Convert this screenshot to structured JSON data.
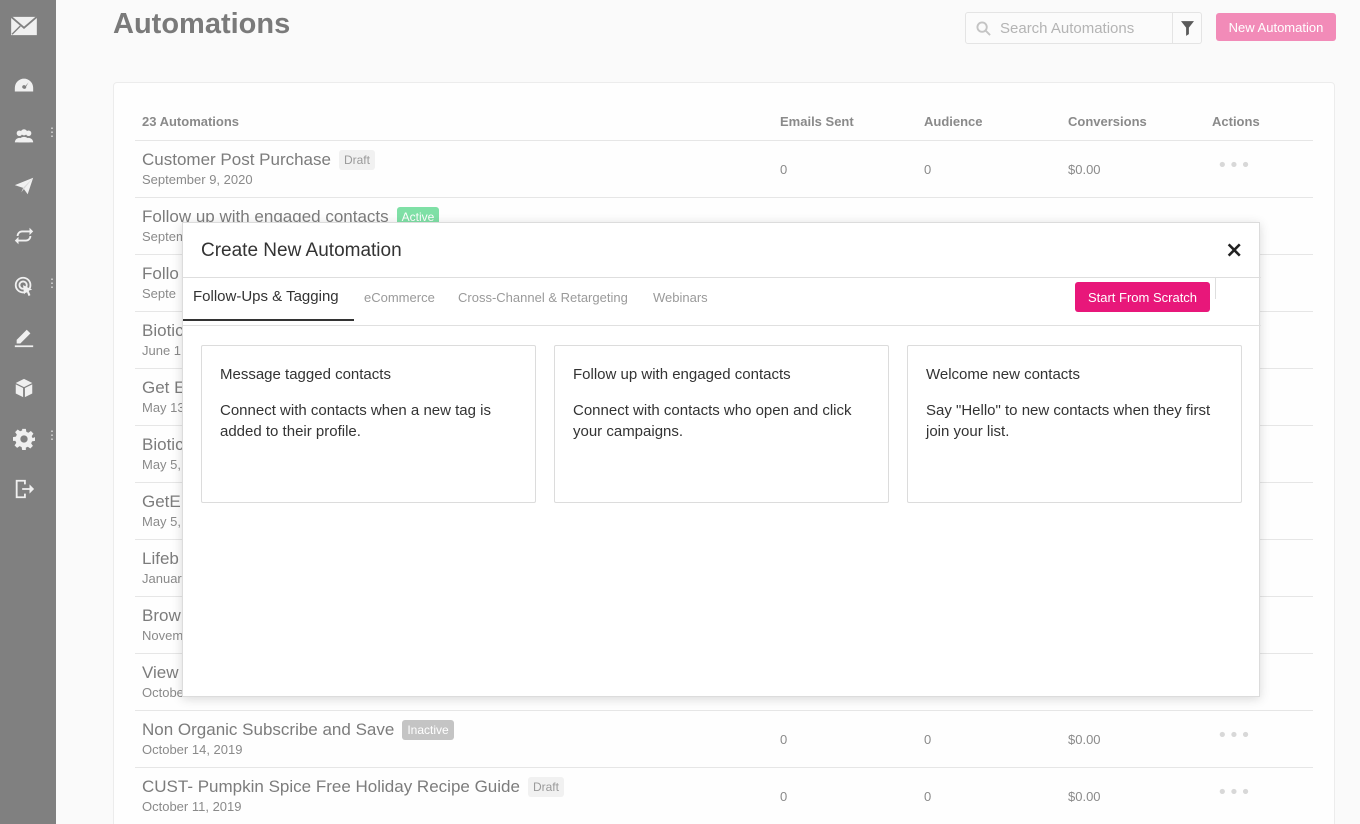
{
  "header": {
    "title": "Automations",
    "search_placeholder": "Search Automations",
    "new_button": "New Automation"
  },
  "table": {
    "count_label": "23 Automations",
    "columns": [
      "Emails Sent",
      "Audience",
      "Conversions",
      "Actions"
    ],
    "rows": [
      {
        "name": "Customer Post Purchase",
        "status": "Draft",
        "date": "September 9, 2020",
        "emails_sent": "0",
        "audience": "0",
        "conversions": "$0.00"
      },
      {
        "name": "Follow up with engaged contacts",
        "status": "Active",
        "date": "Septem"
      },
      {
        "name": "Follo",
        "date": "Septe"
      },
      {
        "name": "Biotic",
        "date": "June 1"
      },
      {
        "name": "Get E",
        "date": "May 13"
      },
      {
        "name": "Biotic",
        "date": "May 5,"
      },
      {
        "name": "GetE",
        "date": "May 5,"
      },
      {
        "name": "Lifeb",
        "date": "Januar"
      },
      {
        "name": "Brow",
        "date": "Novem"
      },
      {
        "name": "View",
        "date": "Octobe"
      },
      {
        "name": "Non Organic Subscribe and Save",
        "status": "Inactive",
        "date": "October 14, 2019",
        "emails_sent": "0",
        "audience": "0",
        "conversions": "$0.00"
      },
      {
        "name": "CUST- Pumpkin Spice Free Holiday Recipe Guide",
        "status": "Draft",
        "date": "October 11, 2019",
        "emails_sent": "0",
        "audience": "0",
        "conversions": "$0.00"
      }
    ]
  },
  "modal": {
    "title": "Create New Automation",
    "close": "×",
    "tabs": [
      "Follow-Ups & Tagging",
      "eCommerce",
      "Cross-Channel & Retargeting",
      "Webinars"
    ],
    "scratch_button": "Start From Scratch",
    "templates": [
      {
        "title": "Message tagged contacts",
        "desc": "Connect with contacts when a new tag is added to their profile."
      },
      {
        "title": "Follow up with engaged contacts",
        "desc": "Connect with contacts who open and click your campaigns."
      },
      {
        "title": "Welcome new contacts",
        "desc": "Say \"Hello\" to new contacts when they first join your list."
      }
    ]
  },
  "sidebar": {
    "icons": [
      "logo-icon",
      "dashboard-icon",
      "contacts-icon",
      "campaigns-icon",
      "automations-icon",
      "signup-forms-icon",
      "landing-pages-icon",
      "integrations-icon",
      "settings-icon",
      "logout-icon"
    ]
  },
  "colors": {
    "sidebar": "#808080",
    "accent": "#e8177a",
    "accent_faded": "#f28bb8",
    "active_badge": "#7fe0a6",
    "inactive_badge": "#c4c4c4"
  }
}
